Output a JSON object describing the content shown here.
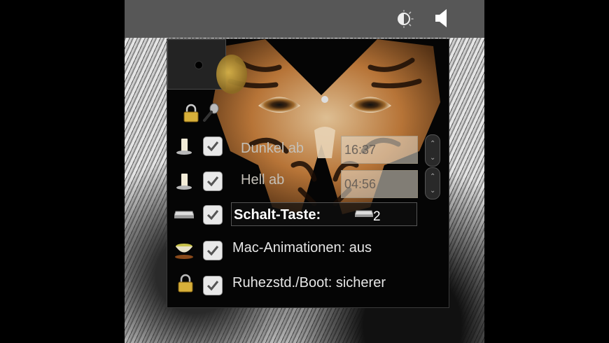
{
  "menubar": {
    "icons": [
      "brightness-icon",
      "volume-icon"
    ]
  },
  "panel": {
    "rows": [
      {
        "label": "Dunkel ab",
        "time": "16:37",
        "checked": true,
        "icon": "candle-icon"
      },
      {
        "label": "Hell ab",
        "time": "04:56",
        "checked": true,
        "icon": "candle-icon"
      },
      {
        "label": "Schalt-Taste:",
        "key_value": "2",
        "checked": true,
        "icon": "key-icon"
      },
      {
        "label": "Mac-Animationen: aus",
        "checked": true,
        "icon": "bowl-icon"
      },
      {
        "label": "Ruhezstd./Boot: sicherer",
        "checked": true,
        "icon": "padlock-icon"
      }
    ]
  },
  "colors": {
    "menubar": "#575757",
    "panel": "#050505",
    "accent_gold": "#d7b44a"
  }
}
